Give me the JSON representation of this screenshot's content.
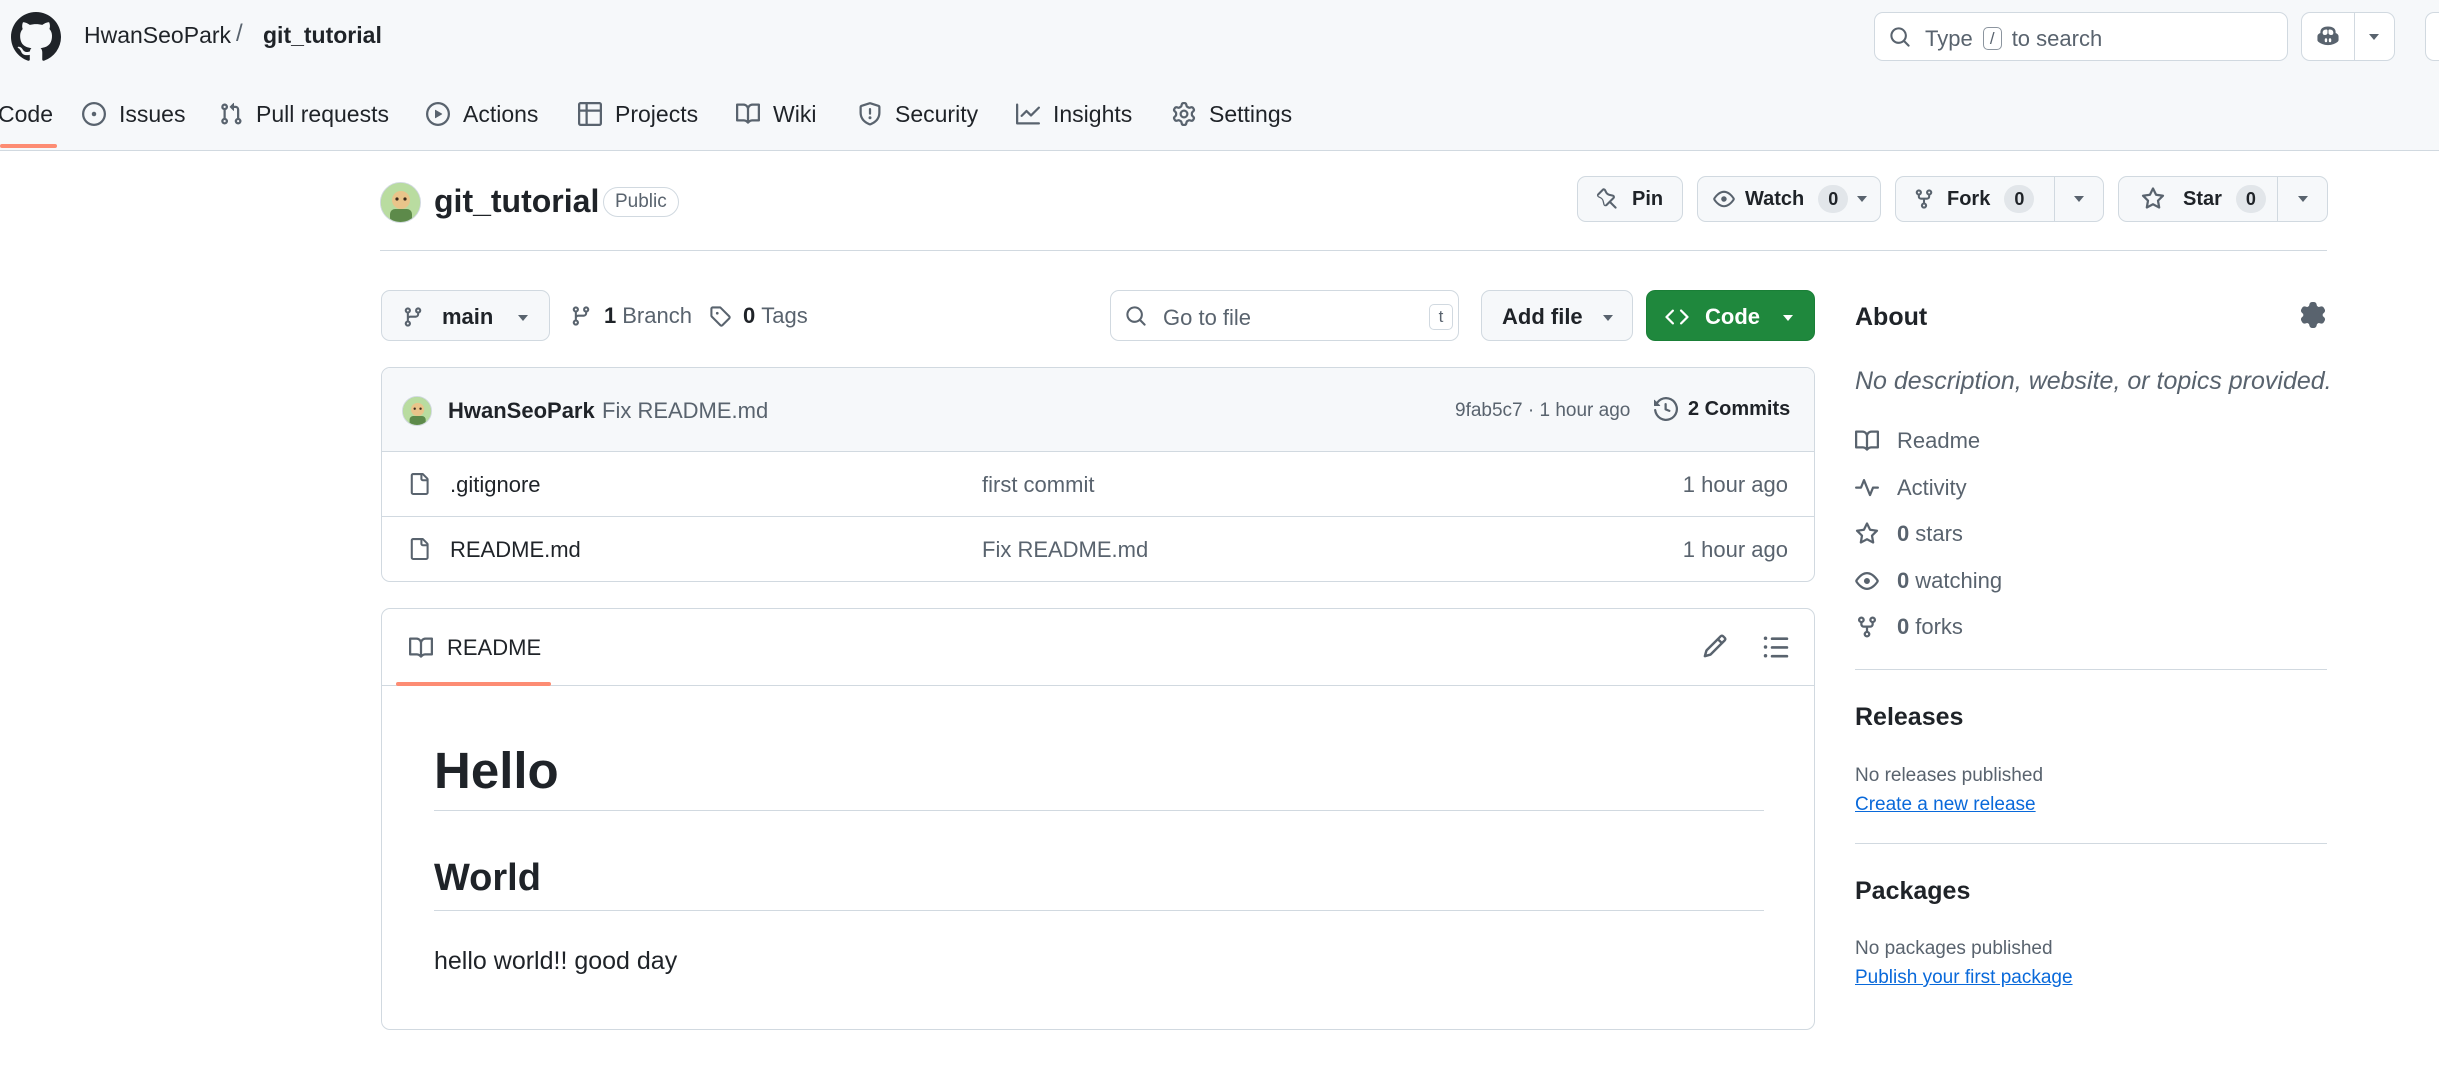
{
  "header": {
    "owner": "HwanSeoPark",
    "separator": "/",
    "repo": "git_tutorial",
    "search": {
      "prefix": "Type",
      "key": "/",
      "suffix": "to search"
    },
    "tabs": [
      {
        "label": "Code",
        "icon": "code-icon",
        "active": true
      },
      {
        "label": "Issues",
        "icon": "issue-icon"
      },
      {
        "label": "Pull requests",
        "icon": "pull-request-icon"
      },
      {
        "label": "Actions",
        "icon": "play-icon"
      },
      {
        "label": "Projects",
        "icon": "table-icon"
      },
      {
        "label": "Wiki",
        "icon": "book-icon"
      },
      {
        "label": "Security",
        "icon": "shield-icon"
      },
      {
        "label": "Insights",
        "icon": "graph-icon"
      },
      {
        "label": "Settings",
        "icon": "gear-icon"
      }
    ]
  },
  "repo": {
    "name": "git_tutorial",
    "visibility": "Public",
    "actions": {
      "pin": "Pin",
      "watch": "Watch",
      "watch_count": "0",
      "fork": "Fork",
      "fork_count": "0",
      "star": "Star",
      "star_count": "0"
    }
  },
  "toolbar": {
    "branch": "main",
    "branches_count": "1",
    "branches_label": "Branch",
    "tags_count": "0",
    "tags_label": "Tags",
    "goto_placeholder": "Go to file",
    "goto_key": "t",
    "add_file": "Add file",
    "code": "Code"
  },
  "latest_commit": {
    "author": "HwanSeoPark",
    "message": "Fix README.md",
    "meta": "9fab5c7 · 1 hour ago",
    "commits_label": "2 Commits"
  },
  "files": [
    {
      "name": ".gitignore",
      "message": "first commit",
      "time": "1 hour ago"
    },
    {
      "name": "README.md",
      "message": "Fix README.md",
      "time": "1 hour ago"
    }
  ],
  "readme": {
    "tab": "README",
    "h1": "Hello",
    "h2": "World",
    "paragraph": "hello world!! good day"
  },
  "sidebar": {
    "about_title": "About",
    "description": "No description, website, or topics provided.",
    "readme": "Readme",
    "activity": "Activity",
    "stars_count": "0",
    "stars_label": "stars",
    "watching_count": "0",
    "watching_label": "watching",
    "forks_count": "0",
    "forks_label": "forks",
    "releases_title": "Releases",
    "releases_empty": "No releases published",
    "releases_link": "Create a new release",
    "packages_title": "Packages",
    "packages_empty": "No packages published",
    "packages_link": "Publish your first package"
  },
  "colors": {
    "accent_green": "#1f883d",
    "tab_underline": "#fd8c73",
    "link": "#0969da"
  }
}
